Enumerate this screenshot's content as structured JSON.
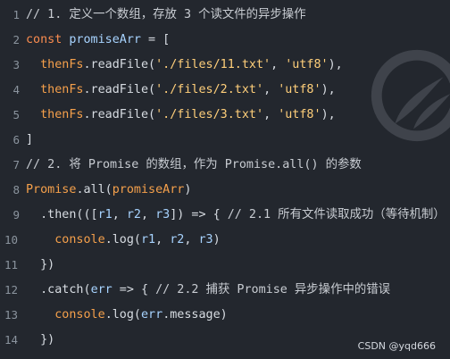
{
  "editor": {
    "background": "#23272e",
    "watermark": "CSDN @yqd666"
  },
  "line_numbers": [
    "1",
    "2",
    "3",
    "4",
    "5",
    "6",
    "7",
    "8",
    "9",
    "10",
    "11",
    "12",
    "13",
    "14"
  ],
  "lines": [
    {
      "parts": [
        {
          "text": "// 1. 定义一个数组，存放 3 个读文件的异步操作",
          "kind": "comment"
        }
      ]
    },
    {
      "parts": [
        {
          "text": "const",
          "kind": "keyword"
        },
        {
          "text": " ",
          "kind": "punct"
        },
        {
          "text": "promiseArr",
          "kind": "identifier"
        },
        {
          "text": " = [",
          "kind": "punct"
        }
      ]
    },
    {
      "parts": [
        {
          "text": "  ",
          "kind": "punct"
        },
        {
          "text": "thenFs",
          "kind": "call"
        },
        {
          "text": ".readFile(",
          "kind": "function"
        },
        {
          "text": "'./files/11.txt'",
          "kind": "string"
        },
        {
          "text": ", ",
          "kind": "punct"
        },
        {
          "text": "'utf8'",
          "kind": "string"
        },
        {
          "text": "),",
          "kind": "punct"
        }
      ]
    },
    {
      "parts": [
        {
          "text": "  ",
          "kind": "punct"
        },
        {
          "text": "thenFs",
          "kind": "call"
        },
        {
          "text": ".readFile(",
          "kind": "function"
        },
        {
          "text": "'./files/2.txt'",
          "kind": "string"
        },
        {
          "text": ", ",
          "kind": "punct"
        },
        {
          "text": "'utf8'",
          "kind": "string"
        },
        {
          "text": "),",
          "kind": "punct"
        }
      ]
    },
    {
      "parts": [
        {
          "text": "  ",
          "kind": "punct"
        },
        {
          "text": "thenFs",
          "kind": "call"
        },
        {
          "text": ".readFile(",
          "kind": "function"
        },
        {
          "text": "'./files/3.txt'",
          "kind": "string"
        },
        {
          "text": ", ",
          "kind": "punct"
        },
        {
          "text": "'utf8'",
          "kind": "string"
        },
        {
          "text": "),",
          "kind": "punct"
        }
      ]
    },
    {
      "parts": [
        {
          "text": "]",
          "kind": "punct"
        }
      ]
    },
    {
      "parts": [
        {
          "text": "// 2. 将 Promise 的数组，作为 Promise.all() 的参数",
          "kind": "comment"
        }
      ]
    },
    {
      "parts": [
        {
          "text": "Promise",
          "kind": "call"
        },
        {
          "text": ".all(",
          "kind": "function"
        },
        {
          "text": "promiseArr",
          "kind": "call"
        },
        {
          "text": ")",
          "kind": "punct"
        }
      ]
    },
    {
      "parts": [
        {
          "text": "  .then(([",
          "kind": "punct"
        },
        {
          "text": "r1",
          "kind": "identifier"
        },
        {
          "text": ", ",
          "kind": "punct"
        },
        {
          "text": "r2",
          "kind": "identifier"
        },
        {
          "text": ", ",
          "kind": "punct"
        },
        {
          "text": "r3",
          "kind": "identifier"
        },
        {
          "text": "]) => { ",
          "kind": "punct"
        },
        {
          "text": "// 2.1 所有文件读取成功（等待机制）",
          "kind": "comment"
        }
      ]
    },
    {
      "parts": [
        {
          "text": "    ",
          "kind": "punct"
        },
        {
          "text": "console",
          "kind": "call"
        },
        {
          "text": ".log(",
          "kind": "function"
        },
        {
          "text": "r1",
          "kind": "identifier"
        },
        {
          "text": ", ",
          "kind": "punct"
        },
        {
          "text": "r2",
          "kind": "identifier"
        },
        {
          "text": ", ",
          "kind": "punct"
        },
        {
          "text": "r3",
          "kind": "identifier"
        },
        {
          "text": ")",
          "kind": "punct"
        }
      ]
    },
    {
      "parts": [
        {
          "text": "  })",
          "kind": "punct"
        }
      ]
    },
    {
      "parts": [
        {
          "text": "  .catch(",
          "kind": "punct"
        },
        {
          "text": "err",
          "kind": "identifier"
        },
        {
          "text": " => { ",
          "kind": "punct"
        },
        {
          "text": "// 2.2 捕获 Promise 异步操作中的错误",
          "kind": "comment"
        }
      ]
    },
    {
      "parts": [
        {
          "text": "    ",
          "kind": "punct"
        },
        {
          "text": "console",
          "kind": "call"
        },
        {
          "text": ".log(",
          "kind": "function"
        },
        {
          "text": "err",
          "kind": "identifier"
        },
        {
          "text": ".message)",
          "kind": "punct"
        }
      ]
    },
    {
      "parts": [
        {
          "text": "  })",
          "kind": "punct"
        }
      ]
    }
  ],
  "colors": {
    "comment": "#c8ccd2",
    "keyword": "#fa8c4f",
    "identifier": "#a7d3ff",
    "string": "#ffcf7a",
    "call": "#f5a04b"
  },
  "icons": [
    "watermark-logo-icon"
  ]
}
